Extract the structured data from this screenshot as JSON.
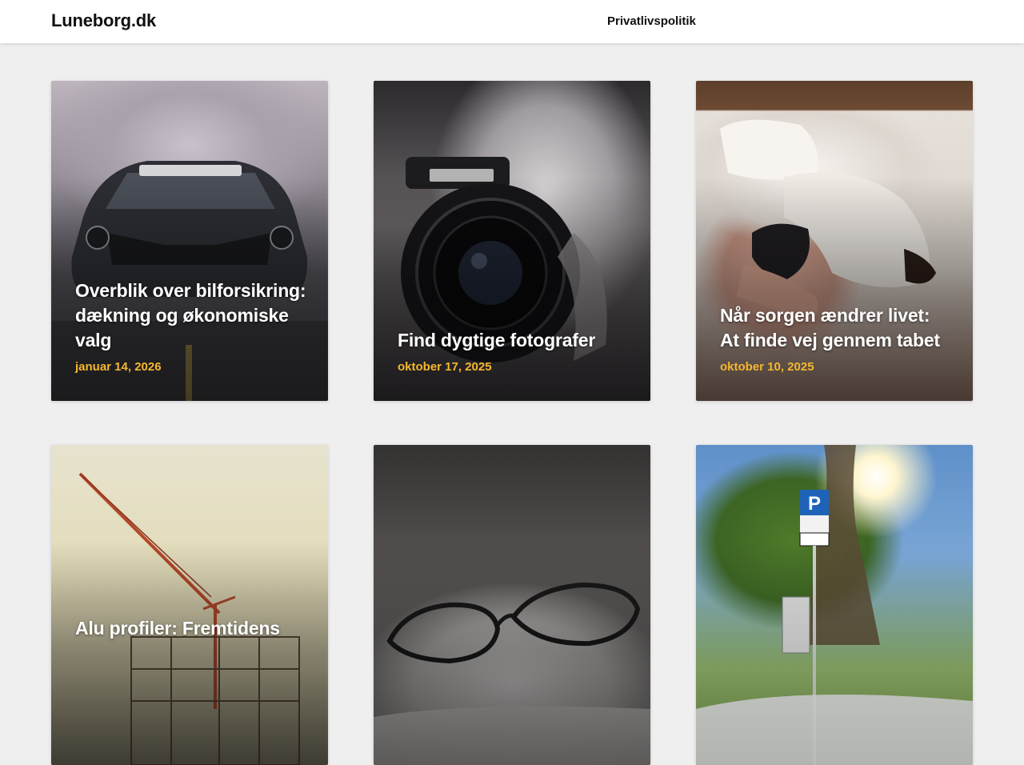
{
  "site": {
    "name": "Luneborg.dk"
  },
  "nav": {
    "privacy_label": "Privatlivspolitik"
  },
  "articles": [
    {
      "title": "Overblik over bilforsikring: dækning og økonomiske valg",
      "date": "januar 14, 2026",
      "image": "car-photo"
    },
    {
      "title": "Find dygtige fotografer",
      "date": "oktober 17, 2025",
      "image": "camera-photo"
    },
    {
      "title": "Når sorgen ændrer livet: At finde vej gennem tabet",
      "date": "oktober 10, 2025",
      "image": "bed-photo"
    },
    {
      "title": "Alu profiler: Fremtidens",
      "date": "",
      "image": "crane-photo"
    },
    {
      "title": "",
      "date": "",
      "image": "glasses-photo"
    },
    {
      "title": "",
      "date": "",
      "image": "parking-photo"
    }
  ],
  "colors": {
    "background": "#efefef",
    "header": "#ffffff",
    "date_accent": "#f5b731",
    "title_text": "#ffffff"
  }
}
